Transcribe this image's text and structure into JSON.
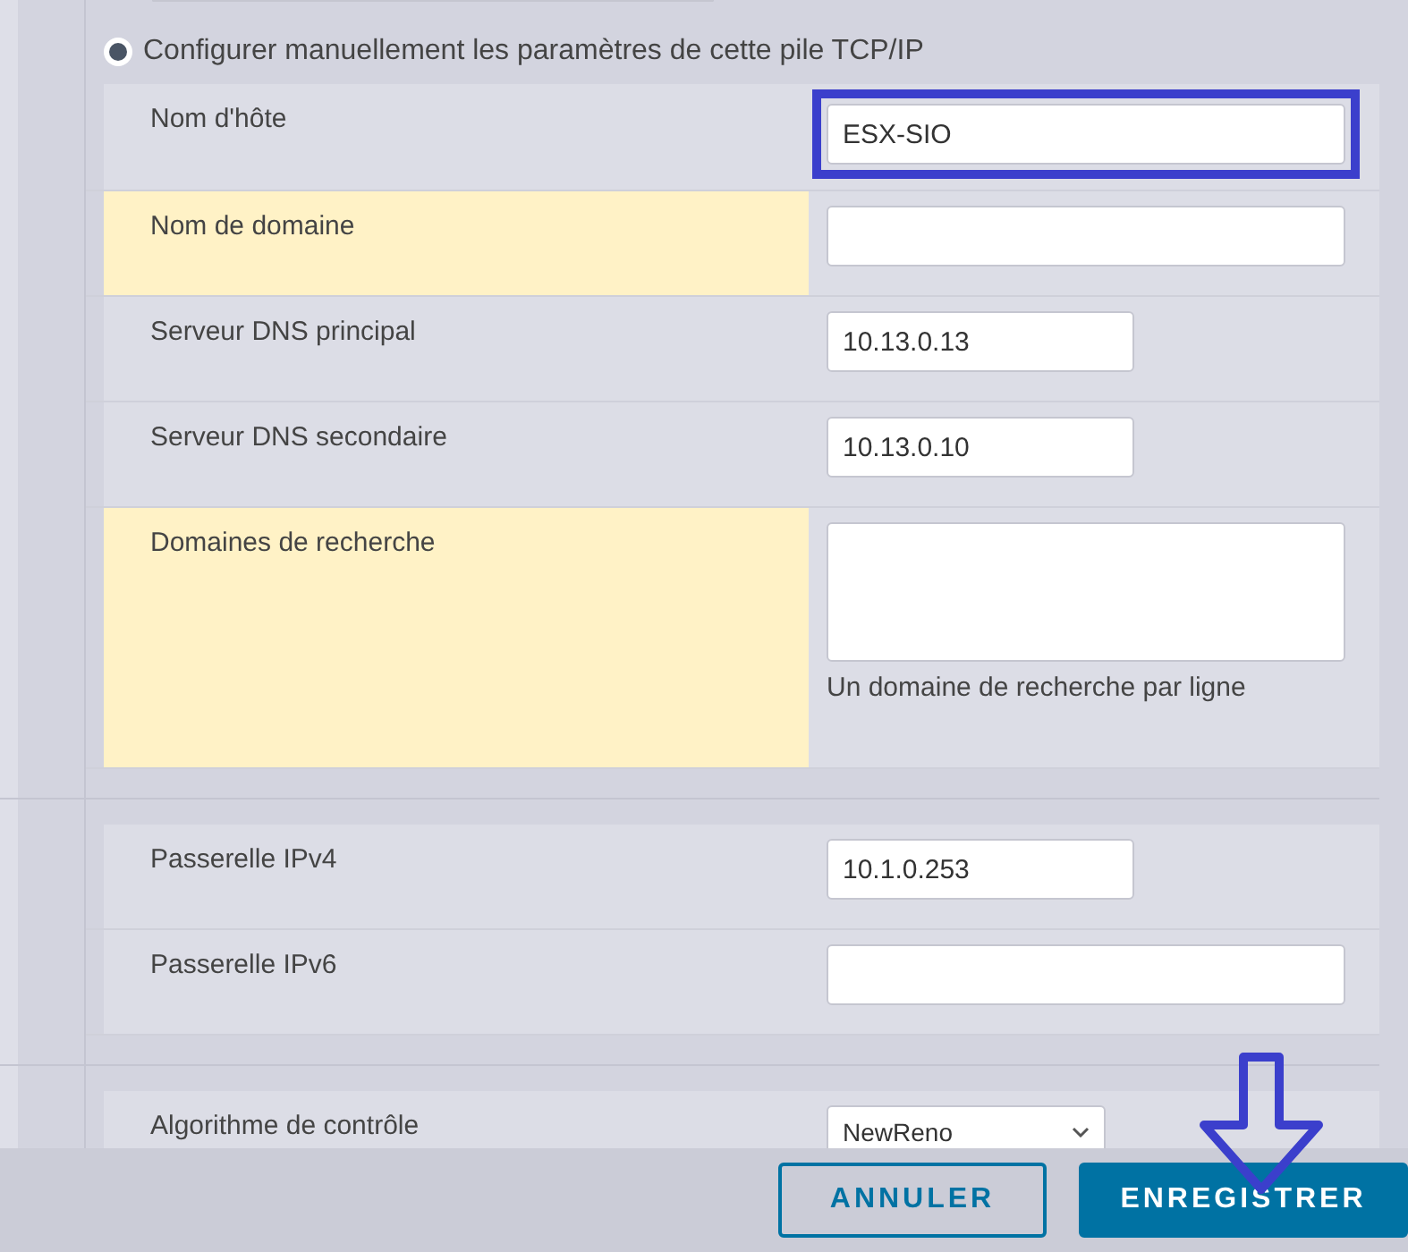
{
  "radio_option": {
    "label": "Configurer manuellement les paramètres de cette pile TCP/IP",
    "selected": true
  },
  "groups": [
    {
      "rows": [
        {
          "label": "Nom d'hôte",
          "kind": "text",
          "value": "ESX-SIO",
          "highlighted": false,
          "annotated": true
        },
        {
          "label": "Nom de domaine",
          "kind": "text",
          "highlighted": true,
          "annotated": false
        },
        {
          "label": "Serveur DNS principal",
          "kind": "short",
          "value": "10.13.0.13",
          "highlighted": false,
          "annotated": false
        },
        {
          "label": "Serveur DNS secondaire",
          "kind": "short",
          "value": "10.13.0.10",
          "highlighted": false,
          "annotated": false
        },
        {
          "label": "Domaines de recherche",
          "kind": "textarea",
          "hint": "Un domaine de recherche par ligne",
          "highlighted": true,
          "annotated": false
        }
      ]
    },
    {
      "rows": [
        {
          "label": "Passerelle IPv4",
          "kind": "short",
          "value": "10.1.0.253",
          "highlighted": false,
          "annotated": false
        },
        {
          "label": "Passerelle IPv6",
          "kind": "text",
          "highlighted": false,
          "annotated": false
        }
      ]
    },
    {
      "rows": [
        {
          "label": "Algorithme de contrôle",
          "kind": "select",
          "value": "NewReno",
          "highlighted": false,
          "annotated": false
        }
      ]
    }
  ],
  "footer_buttons": [
    {
      "label": "ANNULER",
      "kind": "secondary",
      "annotated": false
    },
    {
      "label": "ENREGISTRER",
      "kind": "primary",
      "annotated": true
    }
  ]
}
